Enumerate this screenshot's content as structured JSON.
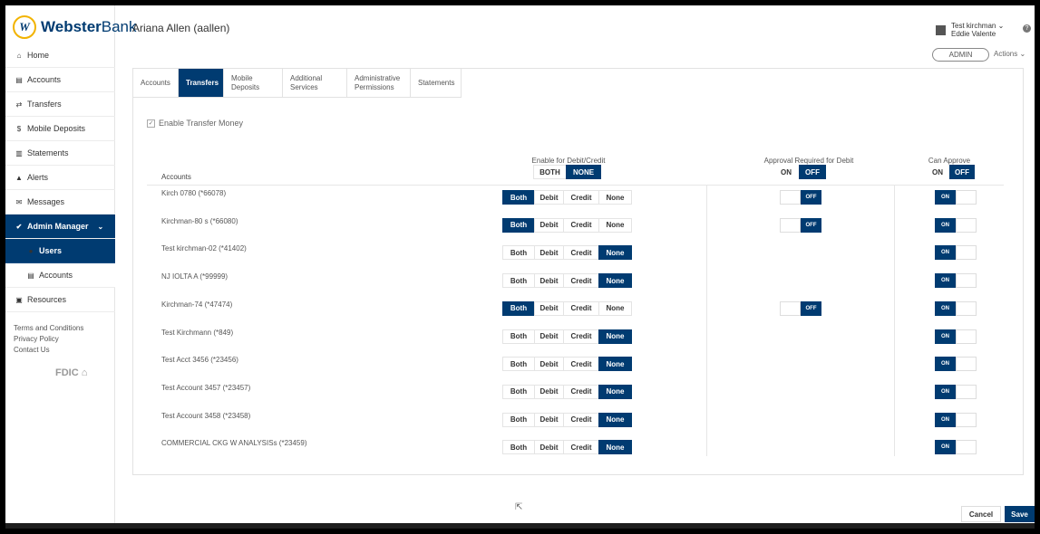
{
  "brand": {
    "logo_letter": "W",
    "name_bold": "Webster",
    "name_rest": "Bank"
  },
  "sidebar": {
    "items": [
      {
        "icon": "home-icon",
        "glyph": "⌂",
        "label": "Home"
      },
      {
        "icon": "accounts-icon",
        "glyph": "▤",
        "label": "Accounts"
      },
      {
        "icon": "transfers-icon",
        "glyph": "⇄",
        "label": "Transfers"
      },
      {
        "icon": "dollar-icon",
        "glyph": "$",
        "label": "Mobile Deposits"
      },
      {
        "icon": "statements-icon",
        "glyph": "▥",
        "label": "Statements"
      },
      {
        "icon": "bell-icon",
        "glyph": "▲",
        "label": "Alerts"
      },
      {
        "icon": "envelope-icon",
        "glyph": "✉",
        "label": "Messages"
      }
    ],
    "admin_manager": {
      "label": "Admin Manager"
    },
    "users": {
      "label": "Users"
    },
    "admin_accounts": {
      "label": "Accounts"
    },
    "resources": {
      "label": "Resources"
    },
    "footer": {
      "terms": "Terms and Conditions",
      "privacy": "Privacy Policy",
      "contact": "Contact Us"
    },
    "fdic": "FDIC"
  },
  "header": {
    "title": "Ariana Allen (aallen)",
    "user_name": "Test kirchman",
    "user_sub": "Eddie Valente",
    "admin_label": "ADMIN",
    "actions_label": "Actions"
  },
  "tabs": [
    {
      "label": "Accounts",
      "active": false
    },
    {
      "label": "Transfers",
      "active": true
    },
    {
      "label": "Mobile Deposits",
      "active": false
    },
    {
      "label": "Additional Services",
      "active": false
    },
    {
      "label": "Administrative Permissions",
      "active": false
    },
    {
      "label": "Statements",
      "active": false
    }
  ],
  "enable_transfer": {
    "label": "Enable Transfer Money",
    "checked": true
  },
  "columns": {
    "accounts": "Accounts",
    "debit_credit": {
      "label": "Enable for Debit/Credit",
      "both": "BOTH",
      "none": "NONE",
      "selected": "NONE"
    },
    "approval": {
      "label": "Approval Required for Debit",
      "on": "ON",
      "off": "OFF",
      "selected": "OFF"
    },
    "can_approve": {
      "label": "Can Approve",
      "on": "ON",
      "off": "OFF",
      "selected": "OFF"
    }
  },
  "option_labels": {
    "both": "Both",
    "debit": "Debit",
    "credit": "Credit",
    "none": "None"
  },
  "toggle_labels": {
    "off": "OFF",
    "on": "ON"
  },
  "accounts": [
    {
      "name": "Kirch 0780 (*66078)",
      "selected": "both",
      "approval": "OFF",
      "can_approve": "ON"
    },
    {
      "name": "Kirchman-80 s (*66080)",
      "selected": "both",
      "approval": "OFF",
      "can_approve": "ON"
    },
    {
      "name": "Test kirchman-02 (*41402)",
      "selected": "none",
      "approval": null,
      "can_approve": "ON"
    },
    {
      "name": "NJ IOLTA A (*99999)",
      "selected": "none",
      "approval": null,
      "can_approve": "ON"
    },
    {
      "name": "Kirchman-74 (*47474)",
      "selected": "both",
      "approval": "OFF",
      "can_approve": "ON"
    },
    {
      "name": "Test Kirchmann (*849)",
      "selected": "none",
      "approval": null,
      "can_approve": "ON"
    },
    {
      "name": "Test Acct 3456 (*23456)",
      "selected": "none",
      "approval": null,
      "can_approve": "ON"
    },
    {
      "name": "Test Account 3457 (*23457)",
      "selected": "none",
      "approval": null,
      "can_approve": "ON"
    },
    {
      "name": "Test Account 3458 (*23458)",
      "selected": "none",
      "approval": null,
      "can_approve": "ON"
    },
    {
      "name": "COMMERCIAL CKG W ANALYSISs (*23459)",
      "selected": "none",
      "approval": null,
      "can_approve": "ON"
    }
  ],
  "footer_buttons": {
    "cancel": "Cancel",
    "save": "Save"
  },
  "colors": {
    "brand_navy": "#003b71",
    "brand_gold": "#f2b300"
  }
}
